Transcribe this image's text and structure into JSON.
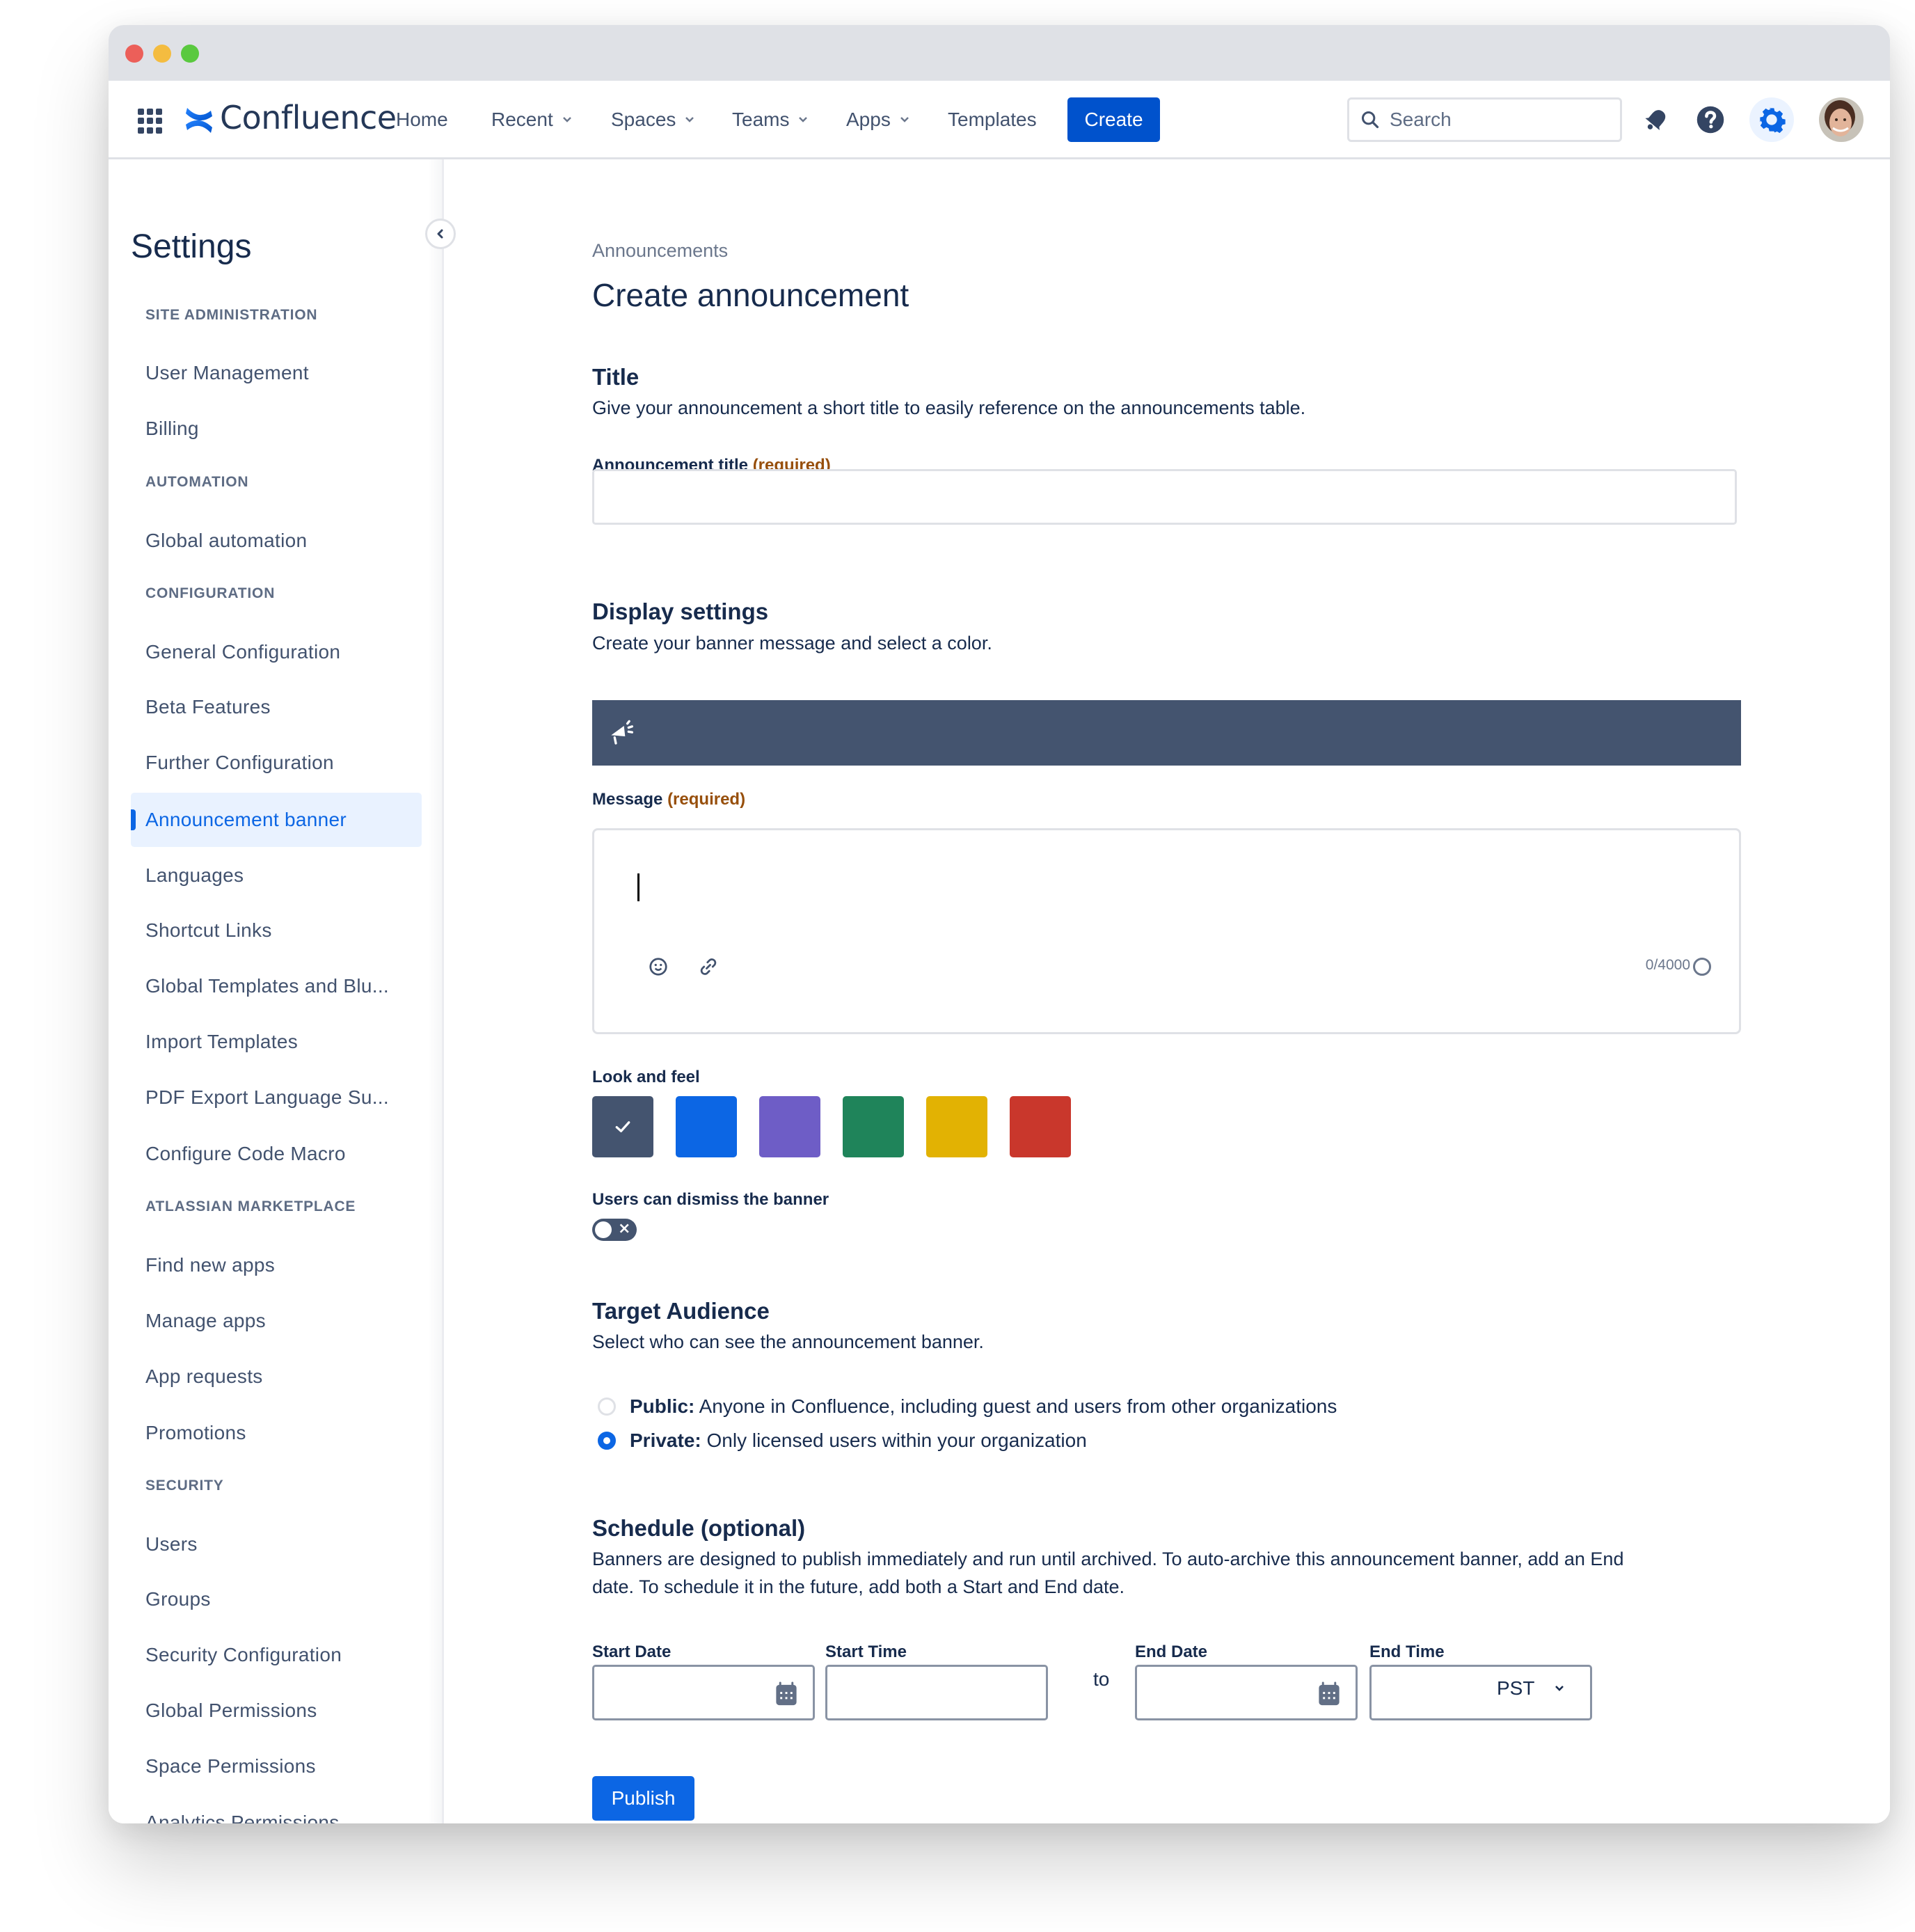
{
  "app": {
    "name": "Confluence",
    "brand_color": "#0c66e4"
  },
  "nav": {
    "items": [
      {
        "label": "Home",
        "has_dropdown": false
      },
      {
        "label": "Recent",
        "has_dropdown": true
      },
      {
        "label": "Spaces",
        "has_dropdown": true
      },
      {
        "label": "Teams",
        "has_dropdown": true
      },
      {
        "label": "Apps",
        "has_dropdown": true
      },
      {
        "label": "Templates",
        "has_dropdown": false
      }
    ],
    "create_label": "Create",
    "search_placeholder": "Search",
    "icons": [
      "app-switcher-icon",
      "notifications-icon",
      "help-icon",
      "settings-icon",
      "avatar"
    ]
  },
  "sidebar": {
    "title": "Settings",
    "sections": [
      {
        "heading": "SITE ADMINISTRATION",
        "items": [
          "User Management",
          "Billing"
        ]
      },
      {
        "heading": "AUTOMATION",
        "items": [
          "Global automation"
        ]
      },
      {
        "heading": "CONFIGURATION",
        "items": [
          "General Configuration",
          "Beta Features",
          "Further Configuration",
          "Announcement banner",
          "Languages",
          "Shortcut Links",
          "Global Templates and Blu...",
          "Import Templates",
          "PDF Export Language Su...",
          "Configure Code Macro"
        ]
      },
      {
        "heading": "ATLASSIAN MARKETPLACE",
        "items": [
          "Find new apps",
          "Manage apps",
          "App requests",
          "Promotions"
        ]
      },
      {
        "heading": "SECURITY",
        "items": [
          "Users",
          "Groups",
          "Security Configuration",
          "Global Permissions",
          "Space Permissions",
          "Analytics Permissions"
        ]
      }
    ],
    "active_item": "Announcement banner"
  },
  "main": {
    "breadcrumb": "Announcements",
    "page_title": "Create announcement",
    "title_section": {
      "heading": "Title",
      "description": "Give your announcement a short title to easily reference on the announcements table.",
      "field_label": "Announcement title",
      "required_label": "(required)",
      "value": ""
    },
    "display_section": {
      "heading": "Display settings",
      "description": "Create your banner message and select a color.",
      "banner_color": "#44546f",
      "message_label": "Message",
      "required_label": "(required)",
      "message_value": "",
      "char_count": "0/4000",
      "look_and_feel_label": "Look and feel",
      "swatches": [
        {
          "name": "neutral",
          "color": "#44546f",
          "selected": true
        },
        {
          "name": "blue",
          "color": "#0c66e4",
          "selected": false
        },
        {
          "name": "purple",
          "color": "#6e5dc6",
          "selected": false
        },
        {
          "name": "green",
          "color": "#1f845a",
          "selected": false
        },
        {
          "name": "yellow",
          "color": "#e2b203",
          "selected": false
        },
        {
          "name": "red",
          "color": "#c9372c",
          "selected": false
        }
      ],
      "dismiss_label": "Users can dismiss the banner",
      "dismiss_enabled": false
    },
    "audience_section": {
      "heading": "Target Audience",
      "description": "Select who can see the announcement banner.",
      "options": [
        {
          "label": "Public:",
          "text": "Anyone in Confluence, including guest and users from other organizations",
          "selected": false
        },
        {
          "label": "Private:",
          "text": "Only licensed users within your organization",
          "selected": true
        }
      ]
    },
    "schedule_section": {
      "heading": "Schedule (optional)",
      "description_line1": "Banners are designed to publish immediately and run until archived. To auto-archive this announcement banner, add an End",
      "description_line2": "date. To schedule it in the future, add both a Start and End date.",
      "start_date_label": "Start Date",
      "start_time_label": "Start Time",
      "to_label": "to",
      "end_date_label": "End Date",
      "end_time_label": "End Time",
      "start_date": "",
      "start_time": "",
      "end_date": "",
      "end_time": "",
      "timezone": "PST"
    },
    "publish_label": "Publish"
  }
}
